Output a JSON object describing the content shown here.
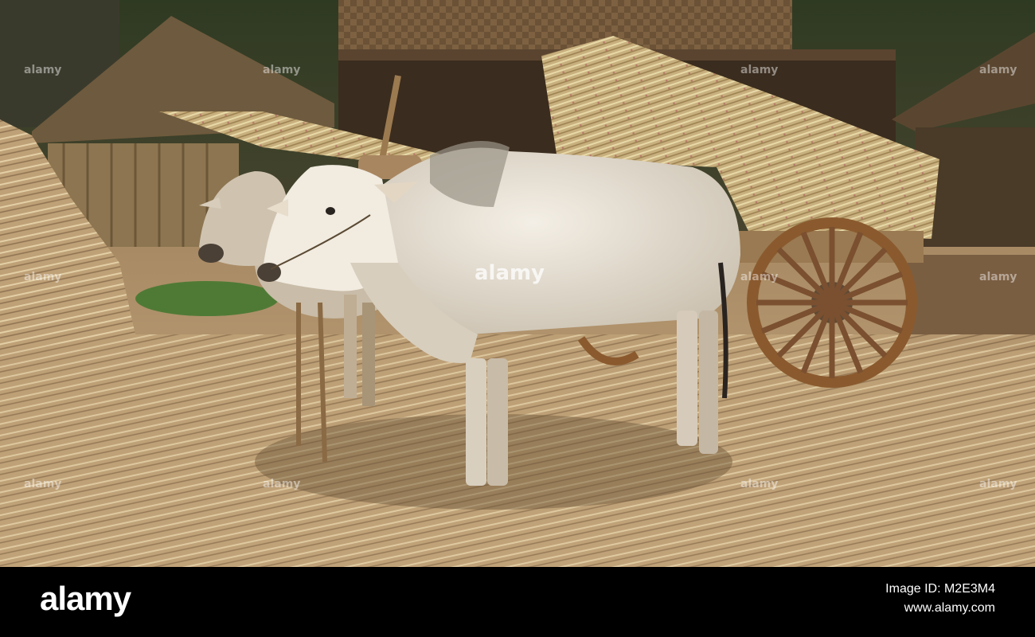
{
  "photo": {
    "subject": "oxen-cart-sugarcane",
    "watermark_text": "alamy"
  },
  "footer": {
    "brand": "alamy",
    "image_id": "Image ID: M2E3M4",
    "url": "www.alamy.com"
  },
  "colors": {
    "footer_background": "#000000",
    "footer_text": "#ffffff",
    "straw": "#c9a97a",
    "ox_white": "#e9e2d6",
    "wood": "#8a5a2e"
  }
}
